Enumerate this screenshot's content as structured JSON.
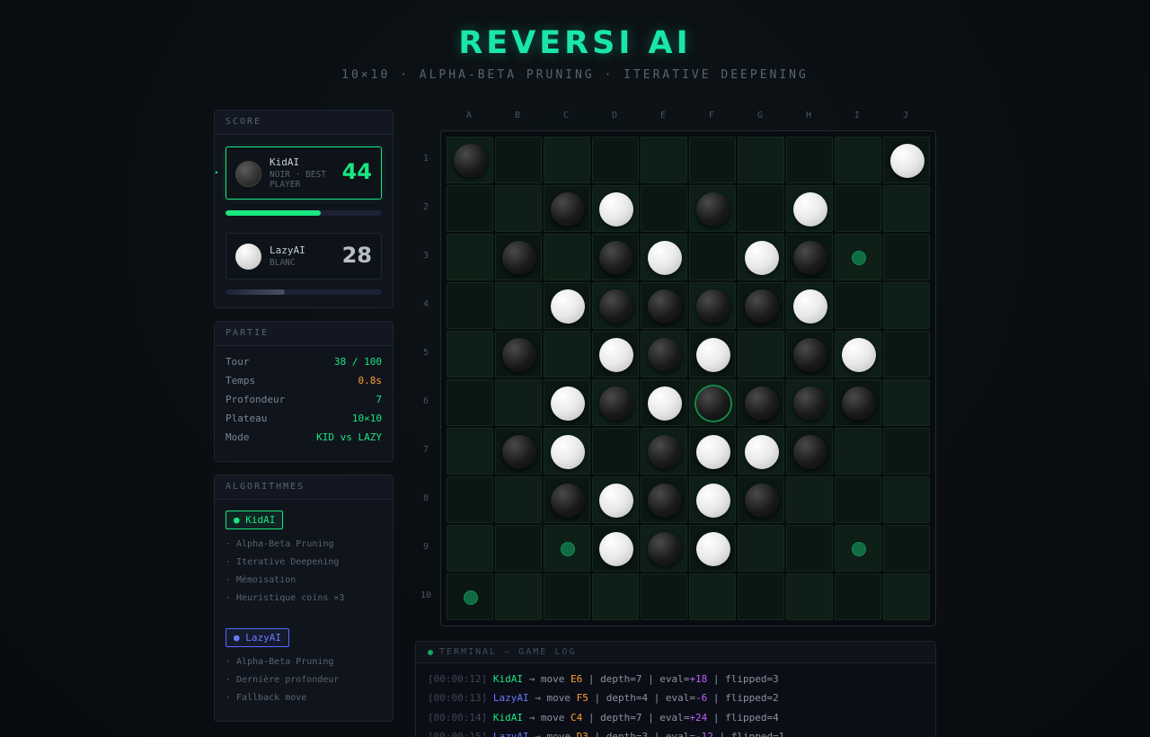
{
  "header": {
    "title": "REVERSI AI",
    "subtitle": "10×10 · ALPHA-BETA PRUNING · ITERATIVE DEEPENING"
  },
  "score": {
    "heading": "SCORE",
    "player1": {
      "name": "KidAI",
      "role": "NOIR · BEST PLAYER",
      "score": "44",
      "bar_fraction": 0.61
    },
    "player2": {
      "name": "LazyAI",
      "role": "BLANC",
      "score": "28",
      "bar_fraction": 0.38
    }
  },
  "partie": {
    "heading": "PARTIE",
    "rows": [
      {
        "key": "Tour",
        "value": "38 / 100",
        "color": "#19e680"
      },
      {
        "key": "Temps",
        "value": "0.8s",
        "color": "#ffa030"
      },
      {
        "key": "Profondeur",
        "value": "7",
        "color": "#19e680"
      },
      {
        "key": "Plateau",
        "value": "10×10",
        "color": "#19e680"
      },
      {
        "key": "Mode",
        "value": "KID vs LAZY",
        "color": "#19e680"
      }
    ]
  },
  "algorithmes": {
    "heading": "ALGORITHMES",
    "kid_label": "KidAI",
    "kid_items": [
      "· Alpha-Beta Pruning",
      "· Iterative Deepening",
      "· Mémoisation",
      "· Heuristique coins ×3"
    ],
    "lazy_label": "LazyAI",
    "lazy_items": [
      "· Alpha-Beta Pruning",
      "· Dernière profondeur",
      "· Fallback move"
    ]
  },
  "board": {
    "columns": [
      "A",
      "B",
      "C",
      "D",
      "E",
      "F",
      "G",
      "H",
      "I",
      "J"
    ],
    "rows": [
      "1",
      "2",
      "3",
      "4",
      "5",
      "6",
      "7",
      "8",
      "9",
      "10"
    ],
    "cells": [
      "B........W",
      "..BW.B.W..",
      ".B.BW.WBh.",
      "..WBBBBW..",
      ".B.WBW.BW.",
      "..WBWBBBB.",
      ".BW.BWWB..",
      "..BWBWB...",
      "..hWBW..h.",
      "h........."
    ],
    "last_move": "F6"
  },
  "terminal": {
    "heading": "TERMINAL — GAME LOG",
    "lines": [
      {
        "ts": "[00:00:12]",
        "player": "KidAI",
        "side": "kid",
        "mv": "E6",
        "depth": "7",
        "eval": "+18",
        "flipped": "3"
      },
      {
        "ts": "[00:00:13]",
        "player": "LazyAI",
        "side": "lazy",
        "mv": "F5",
        "depth": "4",
        "eval": "-6",
        "flipped": "2"
      },
      {
        "ts": "[00:00:14]",
        "player": "KidAI",
        "side": "kid",
        "mv": "C4",
        "depth": "7",
        "eval": "+24",
        "flipped": "4"
      },
      {
        "ts": "[00:00:15]",
        "player": "LazyAI",
        "side": "lazy",
        "mv": "D3",
        "depth": "3",
        "eval": "-12",
        "flipped": "1"
      }
    ]
  },
  "colors": {
    "accent": "#19e6a8",
    "kid": "#19e680",
    "lazy": "#6a7aff",
    "move": "#ffa030",
    "eval": "#c060ff"
  }
}
